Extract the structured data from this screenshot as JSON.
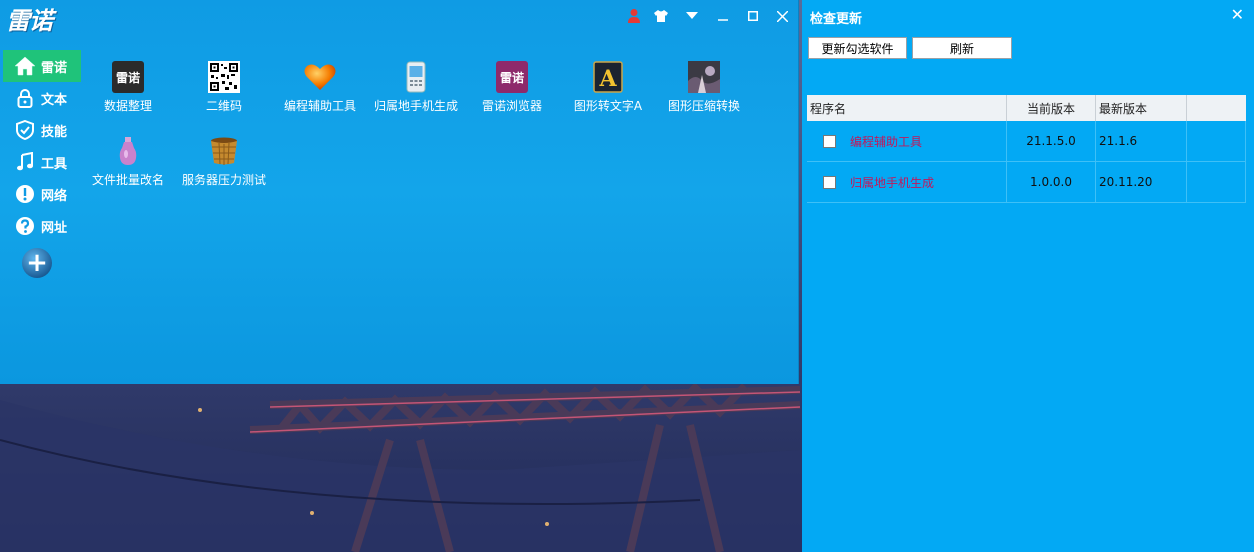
{
  "launcher": {
    "logo": "雷诺",
    "sidebar": [
      {
        "label": "雷诺",
        "icon": "home-icon"
      },
      {
        "label": "文本",
        "icon": "lock-icon"
      },
      {
        "label": "技能",
        "icon": "shield-icon"
      },
      {
        "label": "工具",
        "icon": "music-note-icon"
      },
      {
        "label": "网络",
        "icon": "warning-icon"
      },
      {
        "label": "网址",
        "icon": "help-icon"
      }
    ],
    "apps": [
      {
        "label": "数据整理",
        "icon": "leinuo-logo-icon"
      },
      {
        "label": "二维码",
        "icon": "qr-code-icon"
      },
      {
        "label": "编程辅助工具",
        "icon": "heart-icon"
      },
      {
        "label": "归属地手机生成",
        "icon": "phone-icon"
      },
      {
        "label": "雷诺浏览器",
        "icon": "browser-icon"
      },
      {
        "label": "图形转文字A",
        "icon": "image-to-text-icon"
      },
      {
        "label": "图形压缩转换",
        "icon": "image-compress-icon"
      },
      {
        "label": "文件批量改名",
        "icon": "bottle-icon"
      },
      {
        "label": "服务器压力测试",
        "icon": "basket-icon"
      }
    ]
  },
  "update_panel": {
    "title": "检查更新",
    "update_selected_label": "更新勾选软件",
    "refresh_label": "刷新",
    "columns": [
      "程序名",
      "当前版本",
      "最新版本"
    ],
    "rows": [
      {
        "name": "编程辅助工具",
        "current": "21.1.5.0",
        "latest": "21.1.6",
        "checked": false
      },
      {
        "name": "归属地手机生成",
        "current": "1.0.0.0",
        "latest": "20.11.20",
        "checked": false
      }
    ]
  }
}
